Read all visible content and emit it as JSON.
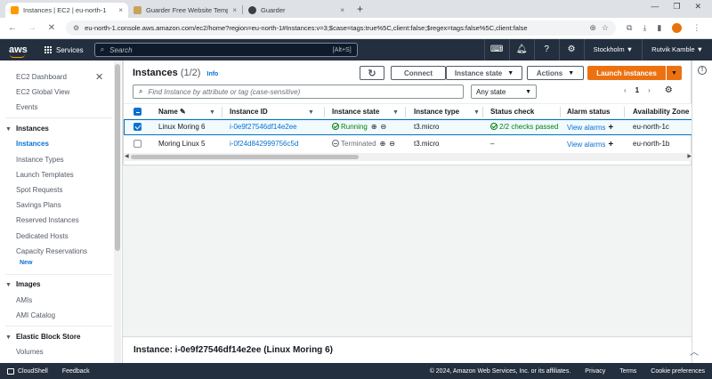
{
  "browser": {
    "tabs": [
      {
        "title": "Instances | EC2 | eu-north-1",
        "close": "×",
        "favicon_color": "#ff9900"
      },
      {
        "title": "Guarder Free Website Template",
        "close": "×",
        "favicon_color": "#c8a25b"
      },
      {
        "title": "Guarder",
        "close": "×",
        "favicon_color": "#3c4043"
      }
    ],
    "new_tab": "+",
    "url": "eu-north-1.console.aws.amazon.com/ec2/home?region=eu-north-1#Instances:v=3;$case=tags:true%5C,client:false;$regex=tags:false%5C,client:false"
  },
  "aws_nav": {
    "logo": "aws",
    "services": "Services",
    "search_placeholder": "Search",
    "search_shortcut": "[Alt+S]",
    "region": "Stockholm ▼",
    "user": "Rutvik Kamble ▼"
  },
  "sidebar": {
    "top_items": [
      "EC2 Dashboard",
      "EC2 Global View",
      "Events"
    ],
    "instances_section": "Instances",
    "instances_items": [
      "Instances",
      "Instance Types",
      "Launch Templates",
      "Spot Requests",
      "Savings Plans",
      "Reserved Instances",
      "Dedicated Hosts",
      "Capacity Reservations"
    ],
    "new_badge": "New",
    "images_section": "Images",
    "images_items": [
      "AMIs",
      "AMI Catalog"
    ],
    "ebs_section": "Elastic Block Store",
    "ebs_items": [
      "Volumes"
    ]
  },
  "main": {
    "title": "Instances",
    "count": "(1/2)",
    "info": "Info",
    "refresh": "↻",
    "connect": "Connect",
    "instance_state": "Instance state",
    "actions": "Actions",
    "launch": "Launch instances",
    "filter_placeholder": "Find Instance by attribute or tag (case-sensitive)",
    "state_filter": "Any state",
    "page": "1",
    "columns": [
      "Name",
      "Instance ID",
      "Instance state",
      "Instance type",
      "Status check",
      "Alarm status",
      "Availability Zone"
    ],
    "rows": [
      {
        "name": "Linux Moring 6",
        "id": "i-0e9f27546df14e2ee",
        "state": "Running",
        "type": "t3.micro",
        "status": "2/2 checks passed",
        "alarm": "View alarms",
        "az": "eu-north-1c",
        "selected": true
      },
      {
        "name": "Moring Linux 5",
        "id": "i-0f24d842999756c5d",
        "state": "Terminated",
        "type": "t3.micro",
        "status": "–",
        "alarm": "View alarms",
        "az": "eu-north-1b",
        "selected": false
      }
    ]
  },
  "detail": {
    "title": "Instance: i-0e9f27546df14e2ee (Linux Moring 6)"
  },
  "footer": {
    "cloudshell": "CloudShell",
    "feedback": "Feedback",
    "copyright": "© 2024, Amazon Web Services, Inc. or its affiliates.",
    "privacy": "Privacy",
    "terms": "Terms",
    "cookies": "Cookie preferences"
  },
  "colors": {
    "aws_nav": "#232f3e",
    "accent": "#ec7211",
    "link": "#0972d3",
    "running": "#037f0c"
  }
}
